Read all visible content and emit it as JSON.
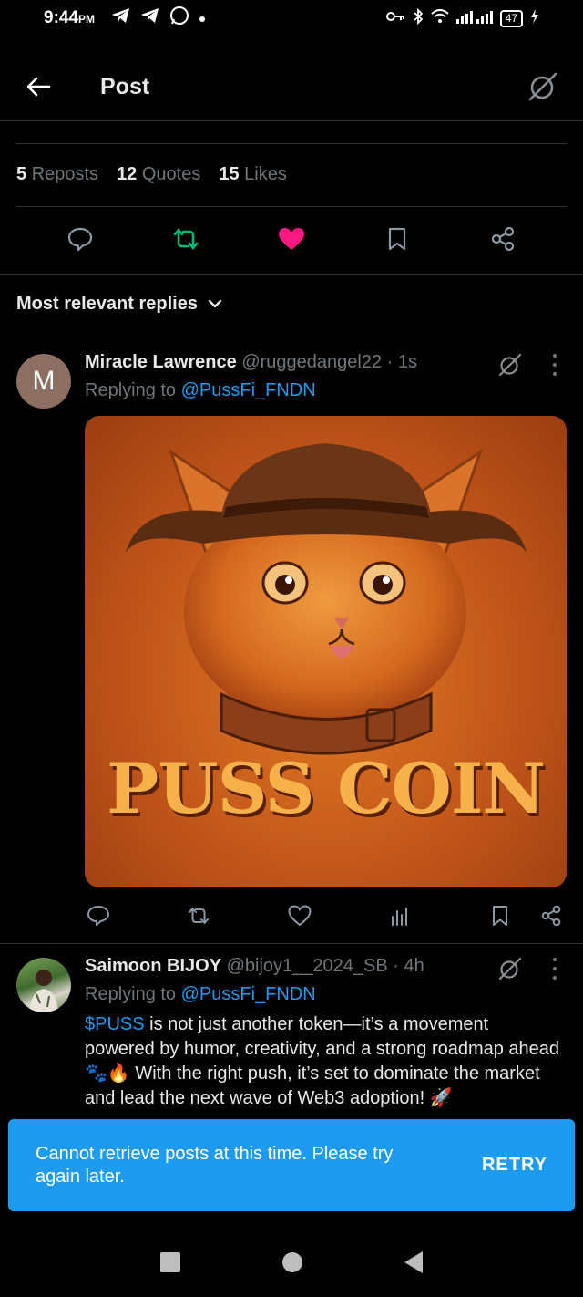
{
  "status_bar": {
    "time": "9:44",
    "ampm": "PM",
    "battery": "47"
  },
  "header": {
    "title": "Post"
  },
  "stats": {
    "reposts_count": "5",
    "reposts_label": "Reposts",
    "quotes_count": "12",
    "quotes_label": "Quotes",
    "likes_count": "15",
    "likes_label": "Likes"
  },
  "sort": {
    "label": "Most relevant replies"
  },
  "replies": [
    {
      "name": "Miracle Lawrence",
      "handle": "@ruggedangel22 · 1s",
      "avatar_letter": "M",
      "replying_prefix": "Replying to ",
      "replying_handle": "@PussFi_FNDN",
      "image_text": "PUSS COIN"
    },
    {
      "name": "Saimoon BIJOY",
      "handle": "@bijoy1__2024_SB · 4h",
      "replying_prefix": "Replying to ",
      "replying_handle": "@PussFi_FNDN",
      "cashtag": "$PUSS",
      "body": " is not just another token—it’s a movement powered by humor, creativity, and a strong roadmap ahead 🐾🔥 With the right push, it’s set to dominate the market and lead the next wave of Web3 adoption! 🚀"
    }
  ],
  "toast": {
    "message": "Cannot retrieve posts at this time. Please try again later.",
    "action": "RETRY"
  },
  "colors": {
    "accent": "#1d9bf0",
    "like": "#f91880",
    "repost": "#00ba7c",
    "background": "#000000"
  }
}
